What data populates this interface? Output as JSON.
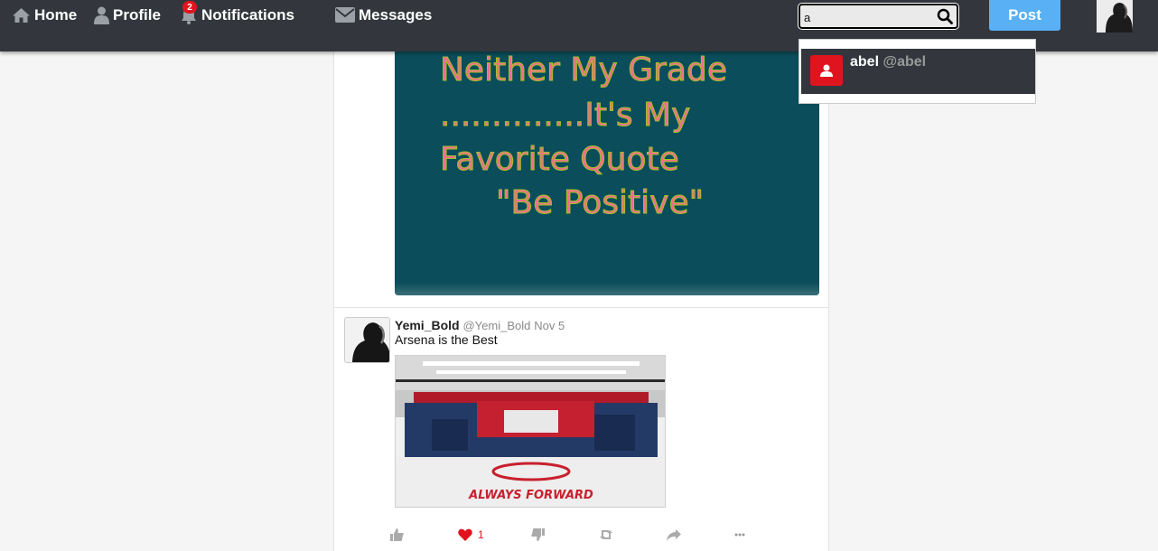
{
  "nav": {
    "home_label": "Home",
    "profile_label": "Profile",
    "notifications_label": "Notifications",
    "notifications_count": "2",
    "messages_label": "Messages",
    "post_label": "Post"
  },
  "search": {
    "value": "a"
  },
  "dropdown": {
    "results": [
      {
        "name": "abel",
        "handle": "@abel"
      }
    ]
  },
  "feed": {
    "posts": [
      {
        "image_lines": [
          "Neither My Grade",
          "..............It's My",
          "Favorite Quote",
          "\"Be Positive\""
        ]
      },
      {
        "author": "Yemi_Bold",
        "handle": "@Yemi_Bold",
        "date": "Nov 5",
        "text": "Arsena is the Best",
        "image_caption": "ALWAYS FORWARD",
        "likes": "1"
      }
    ]
  },
  "colors": {
    "topbar": "#33373d",
    "accent": "#59b0f4",
    "badge": "#e0141e",
    "like": "#e0141e"
  }
}
